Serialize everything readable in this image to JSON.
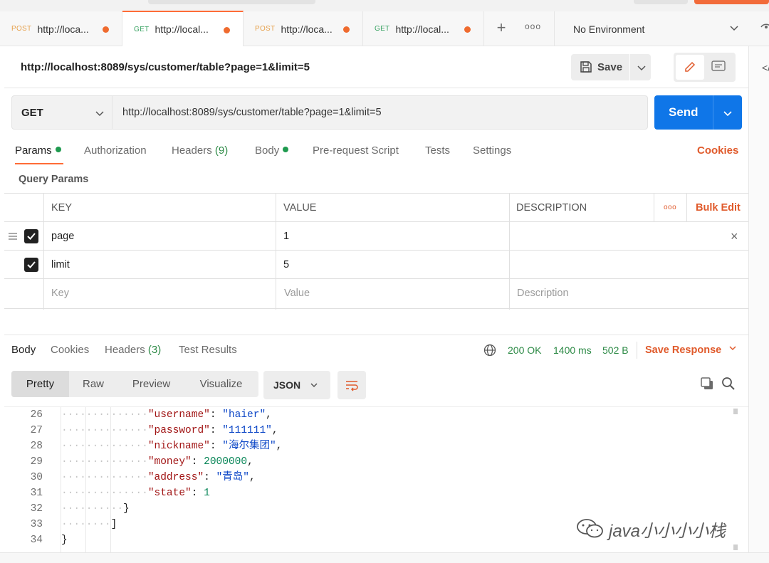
{
  "tabs": [
    {
      "method": "POST",
      "url": "http://loca...",
      "unsaved": true
    },
    {
      "method": "GET",
      "url": "http://local...",
      "unsaved": true,
      "active": true
    },
    {
      "method": "POST",
      "url": "http://loca...",
      "unsaved": true
    },
    {
      "method": "GET",
      "url": "http://local...",
      "unsaved": true
    }
  ],
  "more_tabs": "ooo",
  "environment": "No Environment",
  "request": {
    "title": "http://localhost:8089/sys/customer/table?page=1&limit=5",
    "save_label": "Save",
    "method": "GET",
    "url": "http://localhost:8089/sys/customer/table?page=1&limit=5",
    "send_label": "Send"
  },
  "request_tabs": {
    "params": "Params",
    "authorization": "Authorization",
    "headers": "Headers",
    "headers_count": "(9)",
    "body": "Body",
    "prerequest": "Pre-request Script",
    "tests": "Tests",
    "settings": "Settings",
    "cookies": "Cookies"
  },
  "query_params": {
    "title": "Query Params",
    "columns": {
      "key": "KEY",
      "value": "VALUE",
      "description": "DESCRIPTION"
    },
    "more": "ooo",
    "bulk_edit": "Bulk Edit",
    "rows": [
      {
        "key": "page",
        "value": "1",
        "checked": true
      },
      {
        "key": "limit",
        "value": "5",
        "checked": true
      }
    ],
    "placeholders": {
      "key": "Key",
      "value": "Value",
      "description": "Description"
    }
  },
  "response_tabs": {
    "body": "Body",
    "cookies": "Cookies",
    "headers": "Headers",
    "headers_count": "(3)",
    "test_results": "Test Results"
  },
  "response_status": {
    "status": "200 OK",
    "time": "1400 ms",
    "size": "502 B",
    "save_response": "Save Response"
  },
  "view_modes": [
    "Pretty",
    "Raw",
    "Preview",
    "Visualize"
  ],
  "format": "JSON",
  "code_lines": [
    {
      "n": "26",
      "indent": 3,
      "key": "\"username\"",
      "sep": ": ",
      "val": "\"haier\"",
      "vtype": "str",
      "end": ","
    },
    {
      "n": "27",
      "indent": 3,
      "key": "\"password\"",
      "sep": ": ",
      "val": "\"111111\"",
      "vtype": "str",
      "end": ","
    },
    {
      "n": "28",
      "indent": 3,
      "key": "\"nickname\"",
      "sep": ": ",
      "val": "\"海尔集团\"",
      "vtype": "str",
      "end": ","
    },
    {
      "n": "29",
      "indent": 3,
      "key": "\"money\"",
      "sep": ": ",
      "val": "2000000",
      "vtype": "num",
      "end": ","
    },
    {
      "n": "30",
      "indent": 3,
      "key": "\"address\"",
      "sep": ": ",
      "val": "\"青岛\"",
      "vtype": "str",
      "end": ","
    },
    {
      "n": "31",
      "indent": 3,
      "key": "\"state\"",
      "sep": ": ",
      "val": "1",
      "vtype": "num",
      "end": ""
    },
    {
      "n": "32",
      "indent": 2,
      "key": "",
      "sep": "",
      "val": "",
      "vtype": "",
      "end": "}"
    },
    {
      "n": "33",
      "indent": 1,
      "key": "",
      "sep": "",
      "val": "",
      "vtype": "",
      "end": "]"
    },
    {
      "n": "34",
      "indent": 0,
      "key": "",
      "sep": "",
      "val": "",
      "vtype": "",
      "end": "}"
    }
  ],
  "watermark": "java小小小小栈",
  "colors": {
    "accent": "#ff6c37",
    "send": "#0f76e8",
    "ok": "#2d8a46",
    "link": "#e05a2b"
  }
}
